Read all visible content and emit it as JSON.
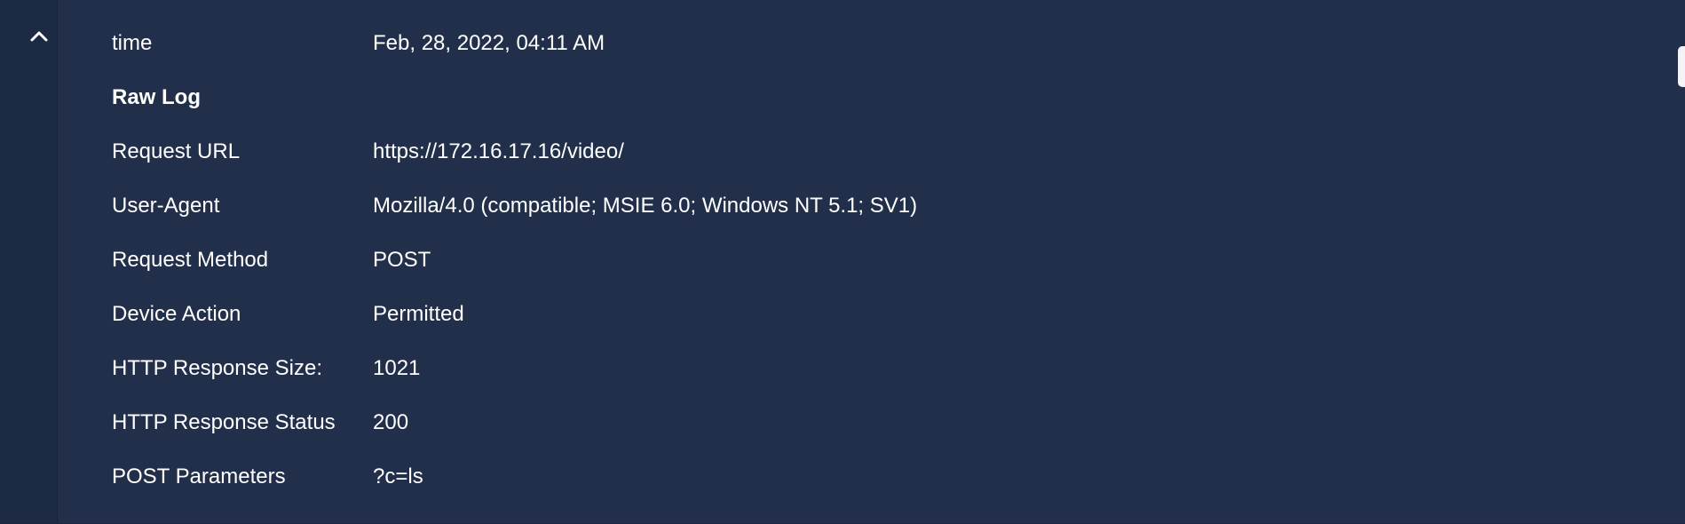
{
  "record": {
    "rows": [
      {
        "label": "time",
        "value": "Feb, 28, 2022, 04:11 AM"
      },
      {
        "label": "Raw Log",
        "value": ""
      },
      {
        "label": "Request URL",
        "value": "https://172.16.17.16/video/"
      },
      {
        "label": "User-Agent",
        "value": "Mozilla/4.0 (compatible; MSIE 6.0; Windows NT 5.1; SV1)"
      },
      {
        "label": "Request Method",
        "value": "POST"
      },
      {
        "label": "Device Action",
        "value": "Permitted"
      },
      {
        "label": "HTTP Response Size:",
        "value": "1021"
      },
      {
        "label": "HTTP Response Status",
        "value": "200"
      },
      {
        "label": "POST Parameters",
        "value": "?c=ls"
      }
    ]
  },
  "icons": {
    "collapse": "chevron-up-icon"
  },
  "colors": {
    "background": "#212f4a",
    "text": "#ffffff"
  }
}
